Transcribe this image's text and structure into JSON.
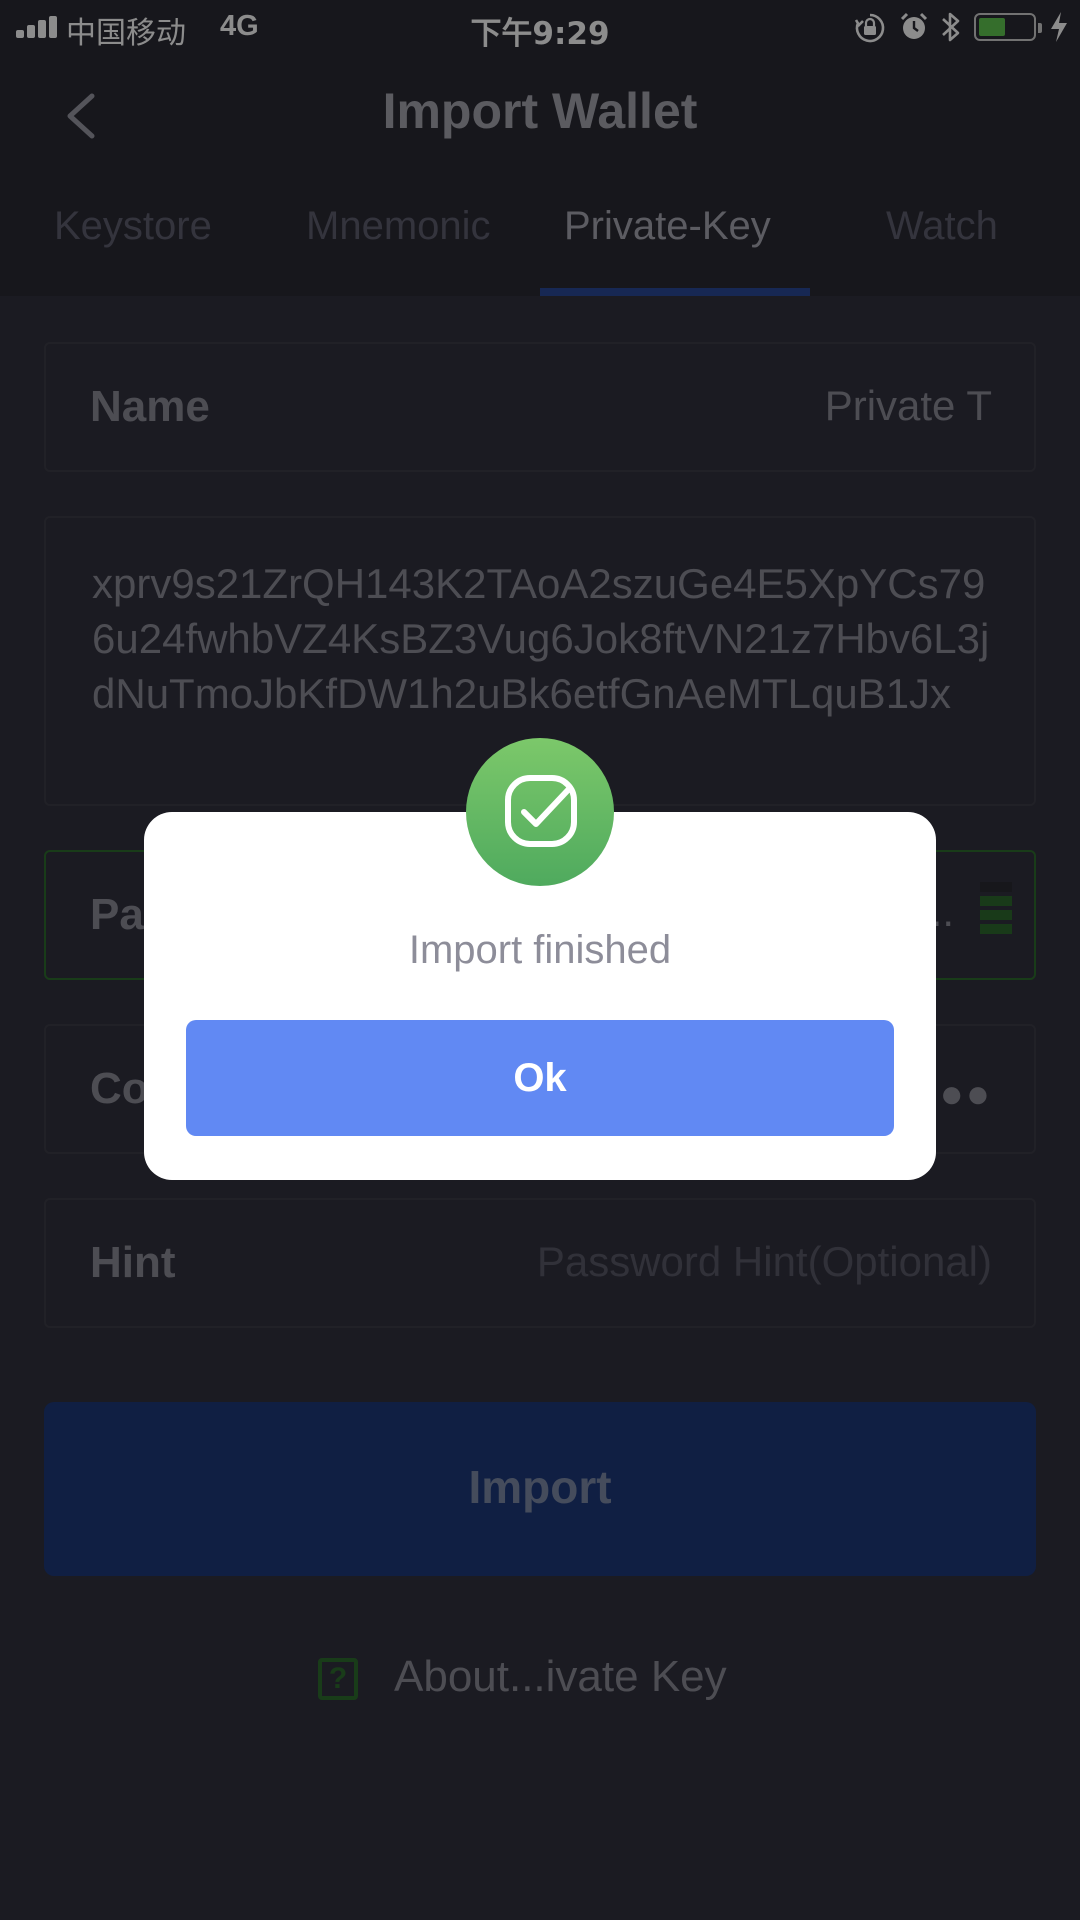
{
  "status_bar": {
    "carrier": "中国移动",
    "network": "4G",
    "time": "下午9:29",
    "battery_level": 0.45,
    "icons": [
      "signal-icon",
      "orientation-lock-icon",
      "alarm-icon",
      "bluetooth-icon",
      "battery-icon",
      "charging-icon"
    ]
  },
  "header": {
    "title": "Import Wallet",
    "back_icon": "chevron-left-icon",
    "tabs": [
      {
        "label": "Keystore",
        "active": false
      },
      {
        "label": "Mnemonic",
        "active": false
      },
      {
        "label": "Private-Key",
        "active": true
      },
      {
        "label": "Watch",
        "active": false
      }
    ]
  },
  "form": {
    "name": {
      "label": "Name",
      "value": "Private T"
    },
    "private_key": "xprv9s21ZrQH143K2TAoA2szuGe4E5XpYCs796u24fwhbVZ4KsBZ3Vug6Jok8ftVN21z7Hbv6L3jdNuTmoJbKfDW1h2uBk6etfGnAeMTLquB1Jx",
    "password": {
      "label_visible": "Pa",
      "value_visible": ".."
    },
    "confirm": {
      "label_visible": "Co",
      "value_visible": "●●"
    },
    "hint": {
      "label": "Hint",
      "placeholder": "Password Hint(Optional)"
    }
  },
  "import_button": {
    "label": "Import"
  },
  "about_link": {
    "label": "About...ivate Key",
    "icon": "question-icon"
  },
  "dialog": {
    "icon": "check-icon",
    "message": "Import finished",
    "ok_label": "Ok"
  },
  "colors": {
    "background": "#32323e",
    "header_bg": "#2a2a33",
    "tab_accent": "#2a4a9a",
    "import_button": "#1e3a7a",
    "ok_button": "#6189f3",
    "success_green": "#5db862",
    "focus_green": "#2f6e2f"
  }
}
